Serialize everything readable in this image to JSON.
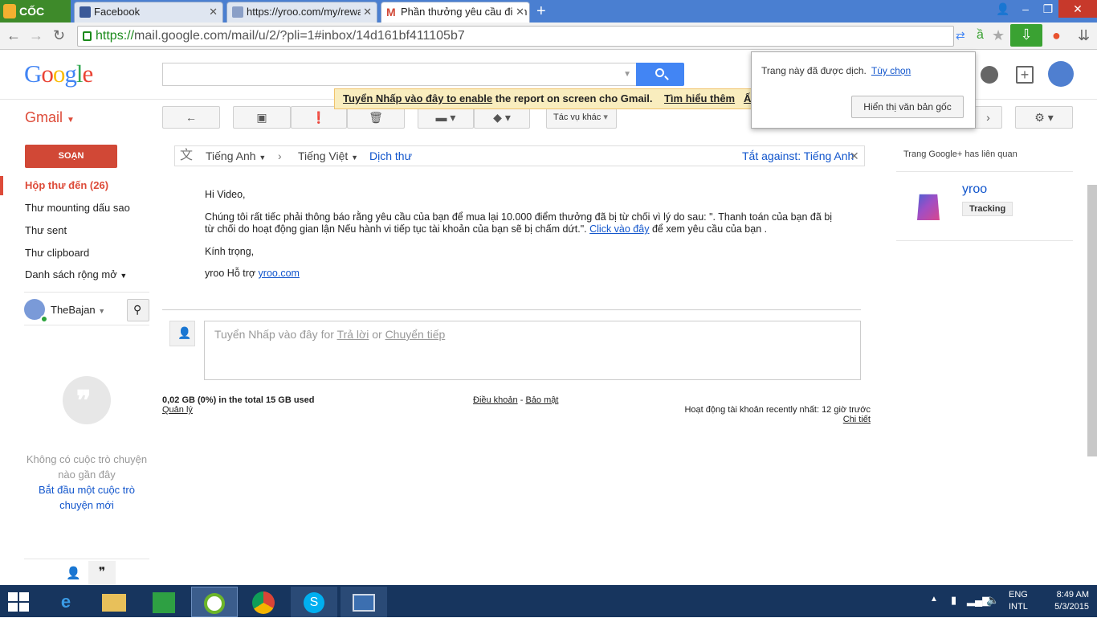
{
  "browser": {
    "brand": "CỐC CỐC",
    "tabs": [
      {
        "title": "Facebook",
        "icon": "facebook-icon"
      },
      {
        "title": "https://yroo.com/my/rewa",
        "icon": "page-icon"
      },
      {
        "title": "Phần thưởng yêu cầu điểm",
        "icon": "gmail-icon"
      }
    ],
    "url_secure": "https://",
    "url_rest": "mail.google.com/mail/u/2/?pli=1#inbox/14d161bf411105b7"
  },
  "header": {
    "logo": "Google",
    "notice": {
      "link": "Tuyển Nhấp vào đây to enable",
      "text": " the report on screen cho Gmail.",
      "learn_more": "Tìm hiểu thêm",
      "extra": "Ấ"
    }
  },
  "translate_popup": {
    "message": "Trang này đã được dịch.",
    "options": "Tùy chọn",
    "show_original": "Hiển thị văn bản gốc"
  },
  "toolbar": {
    "gmail_label": "Gmail",
    "more_actions": "Tác vụ khác"
  },
  "nav": {
    "compose": "SOẠN",
    "items": [
      {
        "label": "Hộp thư đến (26)"
      },
      {
        "label": "Thư mounting dấu sao"
      },
      {
        "label": "Thư sent"
      },
      {
        "label": "Thư clipboard"
      },
      {
        "label": "Danh sách rộng mở"
      }
    ]
  },
  "chat": {
    "user": "TheBajan",
    "empty_text": "Không có cuộc trò chuyện nào gần đây",
    "start_link": "Bắt đầu một cuộc trò chuyện mới"
  },
  "translate_bar": {
    "from": "Tiếng Anh",
    "to": "Tiếng Việt",
    "action": "Dịch thư",
    "turn_off": "Tắt against: Tiếng Anh"
  },
  "message": {
    "greeting": "Hi Video,",
    "body_1": "Chúng tôi rất tiếc phải thông báo rằng yêu cầu của bạn để mua lại 10.000 điểm thưởng đã bị từ chối vì lý do sau: \". Thanh toán của bạn đã bị",
    "body_2": "từ chối do hoạt động gian lận Nếu hành vi tiếp tục tài khoản của bạn sẽ bị chấm dứt.\". ",
    "body_link": "Click vào đây",
    "body_3": " để xem yêu cầu của bạn .",
    "regards": "Kính trọng,",
    "signature": "yroo Hỗ trợ ",
    "signature_link": "yroo.com"
  },
  "reply": {
    "prefix": "Tuyển Nhấp vào đây for ",
    "reply_link": "Trả lời",
    "or": " or ",
    "forward_link": "Chuyển tiếp"
  },
  "footer": {
    "storage": "0,02 GB (0%) in the total 15 GB used",
    "manage": "Quản lý",
    "terms": "Điều khoản",
    "dash": " - ",
    "privacy": "Bảo mật",
    "activity": "Hoạt động tài khoản recently nhất: 12 giờ trước",
    "details": "Chi tiết"
  },
  "right_panel": {
    "title": "Trang Google+ has liên quan",
    "page_name": "yroo",
    "tag": "Tracking"
  },
  "taskbar": {
    "lang_1": "ENG",
    "lang_2": "INTL",
    "time": "8:49 AM",
    "date": "5/3/2015"
  }
}
